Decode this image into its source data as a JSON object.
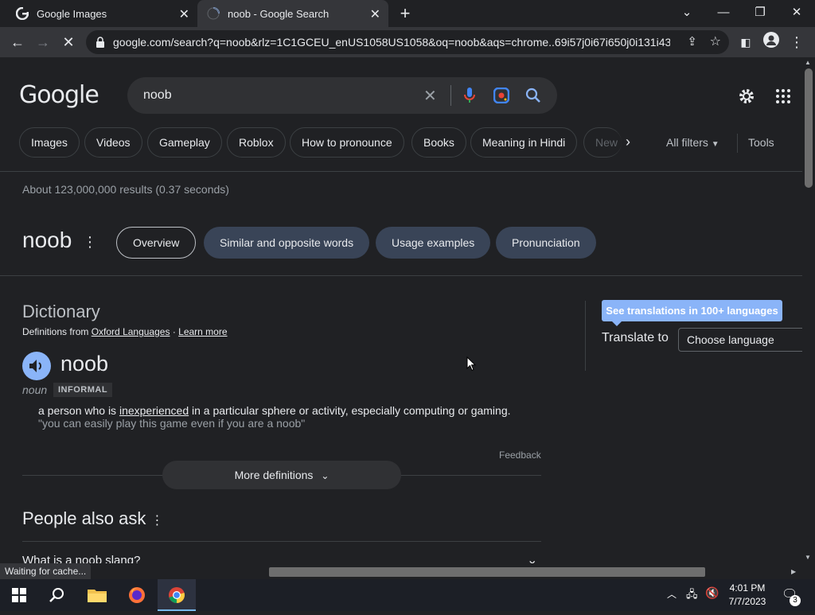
{
  "browser": {
    "tabs": [
      {
        "title": "Google Images"
      },
      {
        "title": "noob - Google Search"
      }
    ],
    "url": "google.com/search?q=noob&rlz=1C1GCEU_enUS1058US1058&oq=noob&aqs=chrome..69i57j0i67i650j0i131i43..."
  },
  "google": {
    "logo": "Google",
    "query": "noob",
    "chips": [
      "Images",
      "Videos",
      "Gameplay",
      "Roblox",
      "How to pronounce",
      "Books",
      "Meaning in Hindi",
      "New"
    ],
    "all_filters": "All filters",
    "tools": "Tools",
    "stats": "About 123,000,000 results (0.37 seconds)"
  },
  "dictionary": {
    "word": "noob",
    "tabs": [
      "Overview",
      "Similar and opposite words",
      "Usage examples",
      "Pronunciation"
    ],
    "heading": "Dictionary",
    "from_prefix": "Definitions from",
    "source": "Oxford Languages",
    "learn_more": "Learn more",
    "headword": "noob",
    "pos": "noun",
    "register": "INFORMAL",
    "definition_pre": "a person who is ",
    "definition_link": "inexperienced",
    "definition_post": " in a particular sphere or activity, especially computing or gaming.",
    "example": "\"you can easily play this game even if you are a noob\"",
    "feedback": "Feedback",
    "more_definitions": "More definitions"
  },
  "translate": {
    "button": "See translations in 100+ languages",
    "label": "Translate to",
    "select": "Choose language"
  },
  "paa": {
    "heading": "People also ask",
    "question": "What is a noob slang?"
  },
  "status": "Waiting for cache...",
  "taskbar": {
    "time": "4:01 PM",
    "date": "7/7/2023",
    "notifications": "3"
  }
}
